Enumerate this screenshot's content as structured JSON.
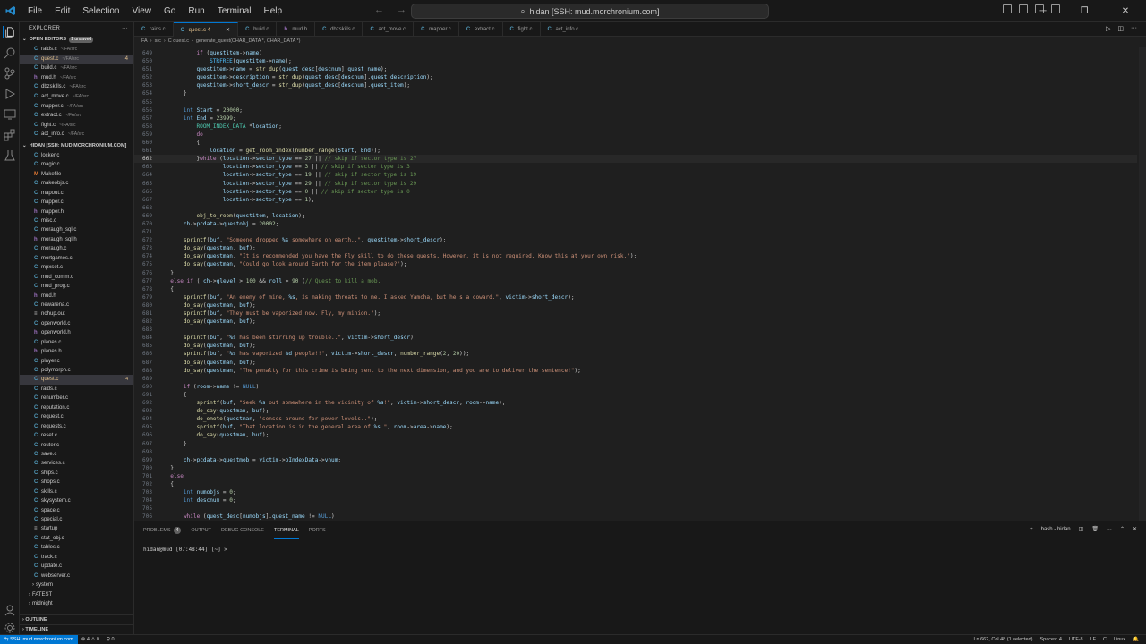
{
  "titlebar": {
    "menu": [
      "File",
      "Edit",
      "Selection",
      "View",
      "Go",
      "Run",
      "Terminal",
      "Help"
    ],
    "command_center": "hidan [SSH: mud.morchronium.com]"
  },
  "sidebar": {
    "title": "EXPLORER",
    "open_editors": {
      "label": "OPEN EDITORS",
      "badge": "1 unsaved",
      "items": [
        {
          "name": "raids.c",
          "desc": "~/FA/src",
          "type": "c"
        },
        {
          "name": "quest.c",
          "desc": "~/FA/src",
          "type": "c",
          "mark": "4"
        },
        {
          "name": "build.c",
          "desc": "~/FA/src",
          "type": "c"
        },
        {
          "name": "mud.h",
          "desc": "~/FA/src",
          "type": "h"
        },
        {
          "name": "dbzskills.c",
          "desc": "~/FA/src",
          "type": "c"
        },
        {
          "name": "act_move.c",
          "desc": "~/FA/src",
          "type": "c"
        },
        {
          "name": "mapper.c",
          "desc": "~/FA/src",
          "type": "c"
        },
        {
          "name": "extract.c",
          "desc": "~/FA/src",
          "type": "c"
        },
        {
          "name": "fight.c",
          "desc": "~/FA/src",
          "type": "c"
        },
        {
          "name": "act_info.c",
          "desc": "~/FA/src",
          "type": "c"
        }
      ]
    },
    "workspace": {
      "label": "HIDAN [SSH: MUD.MORCHRONIUM.COM]",
      "files": [
        {
          "name": "locker.c",
          "type": "c"
        },
        {
          "name": "magic.c",
          "type": "c"
        },
        {
          "name": "Makefile",
          "type": "m"
        },
        {
          "name": "makeobjs.c",
          "type": "c"
        },
        {
          "name": "mapout.c",
          "type": "c"
        },
        {
          "name": "mapper.c",
          "type": "c"
        },
        {
          "name": "mapper.h",
          "type": "h"
        },
        {
          "name": "misc.c",
          "type": "c"
        },
        {
          "name": "moraugh_sql.c",
          "type": "c"
        },
        {
          "name": "moraugh_sql.h",
          "type": "h"
        },
        {
          "name": "moraugh.c",
          "type": "c"
        },
        {
          "name": "mortgames.c",
          "type": "c"
        },
        {
          "name": "mpxset.c",
          "type": "c"
        },
        {
          "name": "mud_comm.c",
          "type": "c"
        },
        {
          "name": "mud_prog.c",
          "type": "c"
        },
        {
          "name": "mud.h",
          "type": "h"
        },
        {
          "name": "newarena.c",
          "type": "c"
        },
        {
          "name": "nohup.out",
          "type": "f"
        },
        {
          "name": "openworld.c",
          "type": "c"
        },
        {
          "name": "openworld.h",
          "type": "h"
        },
        {
          "name": "planes.c",
          "type": "c"
        },
        {
          "name": "planes.h",
          "type": "h"
        },
        {
          "name": "player.c",
          "type": "c"
        },
        {
          "name": "polymorph.c",
          "type": "c"
        },
        {
          "name": "quest.c",
          "type": "c",
          "selected": true,
          "mark": "4"
        },
        {
          "name": "raids.c",
          "type": "c"
        },
        {
          "name": "renumber.c",
          "type": "c"
        },
        {
          "name": "reputation.c",
          "type": "c"
        },
        {
          "name": "request.c",
          "type": "c"
        },
        {
          "name": "requests.c",
          "type": "c"
        },
        {
          "name": "reset.c",
          "type": "c"
        },
        {
          "name": "router.c",
          "type": "c"
        },
        {
          "name": "save.c",
          "type": "c"
        },
        {
          "name": "services.c",
          "type": "c"
        },
        {
          "name": "ships.c",
          "type": "c"
        },
        {
          "name": "shops.c",
          "type": "c"
        },
        {
          "name": "skills.c",
          "type": "c"
        },
        {
          "name": "skysystem.c",
          "type": "c"
        },
        {
          "name": "space.c",
          "type": "c"
        },
        {
          "name": "special.c",
          "type": "c"
        },
        {
          "name": "startup",
          "type": "f"
        },
        {
          "name": "stat_obj.c",
          "type": "c"
        },
        {
          "name": "tables.c",
          "type": "c"
        },
        {
          "name": "track.c",
          "type": "c"
        },
        {
          "name": "update.c",
          "type": "c"
        },
        {
          "name": "webserver.c",
          "type": "c"
        }
      ],
      "folders": [
        "system",
        "FATEST",
        "midnight"
      ]
    },
    "outline": "OUTLINE",
    "timeline": "TIMELINE"
  },
  "tabs": [
    {
      "label": "raids.c",
      "active": false
    },
    {
      "label": "quest.c 4",
      "active": true
    },
    {
      "label": "build.c",
      "active": false
    },
    {
      "label": "mud.h",
      "active": false
    },
    {
      "label": "dbzskills.c",
      "active": false
    },
    {
      "label": "act_move.c",
      "active": false
    },
    {
      "label": "mapper.c",
      "active": false
    },
    {
      "label": "extract.c",
      "active": false
    },
    {
      "label": "fight.c",
      "active": false
    },
    {
      "label": "act_info.c",
      "active": false
    }
  ],
  "breadcrumb": [
    "FA",
    "src",
    "C quest.c",
    "generate_quest(CHAR_DATA *, CHAR_DATA *)"
  ],
  "editor": {
    "lines": [
      {
        "n": "649",
        "html": "<span class='c2'>if</span> (<span class='v'>questitem</span>-&gt;<span class='v'>name</span>)",
        "indent": 5
      },
      {
        "n": "650",
        "html": "<span class='mac'>STRFREE</span>(<span class='v'>questitem</span>-&gt;<span class='v'>name</span>);",
        "indent": 7
      },
      {
        "n": "651",
        "html": "<span class='v'>questitem</span>-&gt;<span class='v'>name</span> = <span class='fn'>str_dup</span>(<span class='v'>quest_desc</span>[<span class='v'>descnum</span>].<span class='v'>quest_name</span>);",
        "indent": 5
      },
      {
        "n": "652",
        "html": "<span class='v'>questitem</span>-&gt;<span class='v'>description</span> = <span class='fn'>str_dup</span>(<span class='v'>quest_desc</span>[<span class='v'>descnum</span>].<span class='v'>quest_description</span>);",
        "indent": 5
      },
      {
        "n": "653",
        "html": "<span class='v'>questitem</span>-&gt;<span class='v'>short_descr</span> = <span class='fn'>str_dup</span>(<span class='v'>quest_desc</span>[<span class='v'>descnum</span>].<span class='v'>quest_item</span>);",
        "indent": 5
      },
      {
        "n": "654",
        "html": "}",
        "indent": 3
      },
      {
        "n": "655",
        "html": "",
        "indent": 0
      },
      {
        "n": "656",
        "html": "<span class='k'>int</span> <span class='v'>Start</span> = <span class='n'>20000</span>;",
        "indent": 3
      },
      {
        "n": "657",
        "html": "<span class='k'>int</span> <span class='v'>End</span> = <span class='n'>23999</span>;",
        "indent": 3
      },
      {
        "n": "658",
        "html": "<span class='t'>ROOM_INDEX_DATA</span> *<span class='v'>location</span>;",
        "indent": 5
      },
      {
        "n": "659",
        "html": "<span class='c2'>do</span>",
        "indent": 5
      },
      {
        "n": "660",
        "html": "{",
        "indent": 5
      },
      {
        "n": "661",
        "html": "<span class='v'>location</span> = <span class='fn'>get_room_index</span>(<span class='fn'>number_range</span>(<span class='v'>Start</span>, <span class='v'>End</span>));",
        "indent": 7
      },
      {
        "n": "662",
        "html": "}<span class='c2'>while</span> (<span class='v'>location</span>-&gt;<span class='v'>sector_type</span> == <span class='n'>27</span> || <span class='cm'>// skip if sector type is 27</span>",
        "indent": 5,
        "current": true
      },
      {
        "n": "663",
        "html": "<span class='v'>location</span>-&gt;<span class='v'>sector_type</span> == <span class='n'>3</span> || <span class='cm'>// skip if sector type is 3</span>",
        "indent": 9
      },
      {
        "n": "664",
        "html": "<span class='v'>location</span>-&gt;<span class='v'>sector_type</span> == <span class='n'>19</span> || <span class='cm'>// skip if sector type is 19</span>",
        "indent": 9
      },
      {
        "n": "665",
        "html": "<span class='v'>location</span>-&gt;<span class='v'>sector_type</span> == <span class='n'>29</span> || <span class='cm'>// skip if sector type is 29</span>",
        "indent": 9
      },
      {
        "n": "666",
        "html": "<span class='v'>location</span>-&gt;<span class='v'>sector_type</span> == <span class='n'>0</span> || <span class='cm'>// skip if sector type is 0</span>",
        "indent": 9
      },
      {
        "n": "667",
        "html": "<span class='v'>location</span>-&gt;<span class='v'>sector_type</span> == <span class='n'>1</span>);",
        "indent": 9
      },
      {
        "n": "668",
        "html": "",
        "indent": 0
      },
      {
        "n": "669",
        "html": "<span class='fn'>obj_to_room</span>(<span class='v'>questitem</span>, <span class='v'>location</span>);",
        "indent": 5
      },
      {
        "n": "670",
        "html": "<span class='v'>ch</span>-&gt;<span class='v'>pcdata</span>-&gt;<span class='v'>questobj</span> = <span class='n'>20002</span>;",
        "indent": 3
      },
      {
        "n": "671",
        "html": "",
        "indent": 0
      },
      {
        "n": "672",
        "html": "<span class='fn'>sprintf</span>(<span class='v'>buf</span>, <span class='s'>\"Someone dropped <span class='v'>%s</span> somewhere on earth..\"</span>, <span class='v'>questitem</span>-&gt;<span class='v'>short_descr</span>);",
        "indent": 3
      },
      {
        "n": "673",
        "html": "<span class='fn'>do_say</span>(<span class='v'>questman</span>, <span class='v'>buf</span>);",
        "indent": 3
      },
      {
        "n": "674",
        "html": "<span class='fn'>do_say</span>(<span class='v'>questman</span>, <span class='s'>\"It is recommended you have the Fly skill to do these quests. However, it is not required. Know this at your own risk.\"</span>);",
        "indent": 3
      },
      {
        "n": "675",
        "html": "<span class='fn'>do_say</span>(<span class='v'>questman</span>, <span class='s'>\"Could go look around Earth for the item please?\"</span>);",
        "indent": 3
      },
      {
        "n": "676",
        "html": "}",
        "indent": 1
      },
      {
        "n": "677",
        "html": "<span class='c2'>else if</span> ( <span class='v'>ch</span>-&gt;<span class='v'>glevel</span> &gt; <span class='n'>100</span> &amp;&amp; <span class='v'>roll</span> &gt; <span class='n'>90</span> )<span class='cm'>// Quest to kill a mob.</span>",
        "indent": 1
      },
      {
        "n": "678",
        "html": "{",
        "indent": 1
      },
      {
        "n": "679",
        "html": "<span class='fn'>sprintf</span>(<span class='v'>buf</span>, <span class='s'>\"An enemy of mine, <span class='v'>%s</span>, is making threats to me. I asked Yamcha, but he's a coward.\"</span>, <span class='v'>victim</span>-&gt;<span class='v'>short_descr</span>);",
        "indent": 3
      },
      {
        "n": "680",
        "html": "<span class='fn'>do_say</span>(<span class='v'>questman</span>, <span class='v'>buf</span>);",
        "indent": 3
      },
      {
        "n": "681",
        "html": "<span class='fn'>sprintf</span>(<span class='v'>buf</span>, <span class='s'>\"They must be vaporized now. Fly, my minion.\"</span>);",
        "indent": 3
      },
      {
        "n": "682",
        "html": "<span class='fn'>do_say</span>(<span class='v'>questman</span>, <span class='v'>buf</span>);",
        "indent": 3
      },
      {
        "n": "683",
        "html": "",
        "indent": 0
      },
      {
        "n": "684",
        "html": "<span class='fn'>sprintf</span>(<span class='v'>buf</span>, <span class='s'>\"<span class='v'>%s</span> has been stirring up trouble..\"</span>, <span class='v'>victim</span>-&gt;<span class='v'>short_descr</span>);",
        "indent": 3
      },
      {
        "n": "685",
        "html": "<span class='fn'>do_say</span>(<span class='v'>questman</span>, <span class='v'>buf</span>);",
        "indent": 3
      },
      {
        "n": "686",
        "html": "<span class='fn'>sprintf</span>(<span class='v'>buf</span>, <span class='s'>\"<span class='v'>%s</span> has vaporized <span class='v'>%d</span> people!!\"</span>, <span class='v'>victim</span>-&gt;<span class='v'>short_descr</span>, <span class='fn'>number_range</span>(<span class='n'>2</span>, <span class='n'>20</span>));",
        "indent": 3
      },
      {
        "n": "687",
        "html": "<span class='fn'>do_say</span>(<span class='v'>questman</span>, <span class='v'>buf</span>);",
        "indent": 3
      },
      {
        "n": "688",
        "html": "<span class='fn'>do_say</span>(<span class='v'>questman</span>, <span class='s'>\"The penalty for this crime is being sent to the next dimension, and you are to deliver the sentence!\"</span>);",
        "indent": 3
      },
      {
        "n": "689",
        "html": "",
        "indent": 0
      },
      {
        "n": "690",
        "html": "<span class='c2'>if</span> (<span class='v'>room</span>-&gt;<span class='v'>name</span> != <span class='k'>NULL</span>)",
        "indent": 3
      },
      {
        "n": "691",
        "html": "{",
        "indent": 3
      },
      {
        "n": "692",
        "html": "<span class='fn'>sprintf</span>(<span class='v'>buf</span>, <span class='s'>\"Seek <span class='v'>%s</span> out somewhere in the vicinity of <span class='v'>%s</span>!\"</span>, <span class='v'>victim</span>-&gt;<span class='v'>short_descr</span>, <span class='v'>room</span>-&gt;<span class='v'>name</span>);",
        "indent": 5
      },
      {
        "n": "693",
        "html": "<span class='fn'>do_say</span>(<span class='v'>questman</span>, <span class='v'>buf</span>);",
        "indent": 5
      },
      {
        "n": "694",
        "html": "<span class='fn'>do_emote</span>(<span class='v'>questman</span>, <span class='s'>\"senses around for power levels..\"</span>);",
        "indent": 5
      },
      {
        "n": "695",
        "html": "<span class='fn'>sprintf</span>(<span class='v'>buf</span>, <span class='s'>\"That location is in the general area of <span class='v'>%s</span>.\"</span>, <span class='v'>room</span>-&gt;<span class='v'>area</span>-&gt;<span class='v'>name</span>);",
        "indent": 5
      },
      {
        "n": "696",
        "html": "<span class='fn'>do_say</span>(<span class='v'>questman</span>, <span class='v'>buf</span>);",
        "indent": 5
      },
      {
        "n": "697",
        "html": "}",
        "indent": 3
      },
      {
        "n": "698",
        "html": "",
        "indent": 0
      },
      {
        "n": "699",
        "html": "<span class='v'>ch</span>-&gt;<span class='v'>pcdata</span>-&gt;<span class='v'>questmob</span> = <span class='v'>victim</span>-&gt;<span class='v'>pIndexData</span>-&gt;<span class='v'>vnum</span>;",
        "indent": 3
      },
      {
        "n": "700",
        "html": "}",
        "indent": 1
      },
      {
        "n": "701",
        "html": "<span class='c2'>else</span>",
        "indent": 1
      },
      {
        "n": "702",
        "html": "{",
        "indent": 1
      },
      {
        "n": "703",
        "html": "<span class='k'>int</span> <span class='v'>numobjs</span> = <span class='n'>0</span>;",
        "indent": 3
      },
      {
        "n": "704",
        "html": "<span class='k'>int</span> <span class='v'>descnum</span> = <span class='n'>0</span>;",
        "indent": 3
      },
      {
        "n": "705",
        "html": "",
        "indent": 0
      },
      {
        "n": "706",
        "html": "<span class='c2'>while</span> (<span class='v'>quest_desc</span>[<span class='v'>numobjs</span>].<span class='v'>quest_name</span> != <span class='k'>NULL</span>)",
        "indent": 3
      }
    ]
  },
  "panel": {
    "tabs": [
      {
        "label": "PROBLEMS",
        "count": "4"
      },
      {
        "label": "OUTPUT"
      },
      {
        "label": "DEBUG CONSOLE"
      },
      {
        "label": "TERMINAL",
        "active": true
      },
      {
        "label": "PORTS"
      }
    ],
    "terminal_name": "bash - hidan",
    "prompt": "hidan@mud [07:48:44] [~] >"
  },
  "statusbar": {
    "remote": "SSH: mud.morchronium.com",
    "problems": "⊗ 4 ⚠ 0",
    "ports": "⚲ 0",
    "position": "Ln 662, Col 48 (1 selected)",
    "spaces": "Spaces: 4",
    "encoding": "UTF-8",
    "eol": "LF",
    "language": "C",
    "platform": "Linux"
  },
  "colors": {
    "accent": "#0078d4",
    "modified": "#e2c08d",
    "background": "#1f1f1f"
  }
}
